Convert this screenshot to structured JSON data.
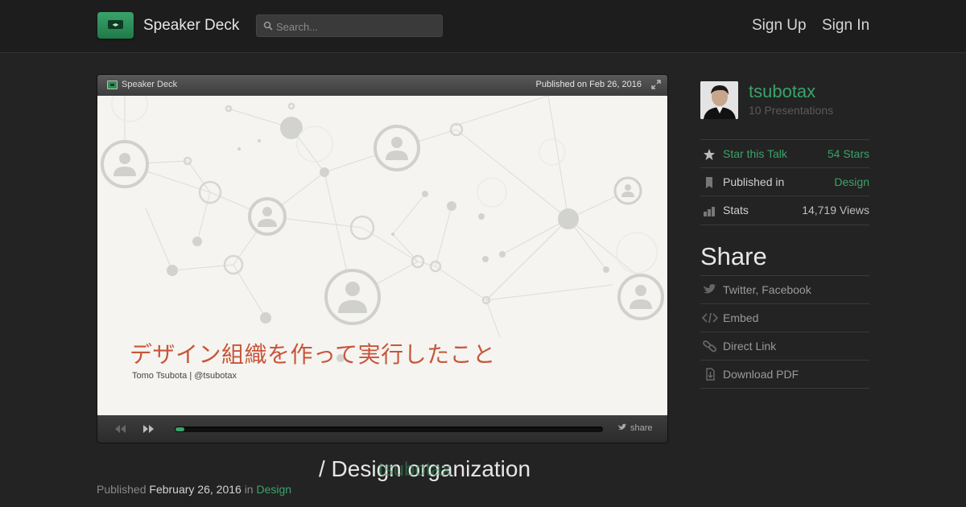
{
  "header": {
    "brand": "Speaker Deck",
    "search_placeholder": "Search...",
    "sign_up": "Sign Up",
    "sign_in": "Sign In"
  },
  "player": {
    "brand": "Speaker Deck",
    "published": "Published on Feb 26, 2016",
    "slide_title": "デザイン組織を作って実行したこと",
    "slide_author": "Tomo Tsubota  |  @tsubotax",
    "share_label": "share",
    "progress_fraction": 0.02
  },
  "talk": {
    "title": "/ Design organization",
    "overlay_author": "tsubotax",
    "published_prefix": "Published",
    "published_date": "February 26, 2016",
    "published_in": "in",
    "category": "Design"
  },
  "sidebar": {
    "author_name": "tsubotax",
    "presentations": "10 Presentations",
    "stats": [
      {
        "icon": "star-icon",
        "label": "Star this Talk",
        "value": "54 Stars"
      },
      {
        "icon": "bookmark-icon",
        "label": "Published in",
        "value": "Design"
      },
      {
        "icon": "bar-chart-icon",
        "label": "Stats",
        "value": "14,719 Views"
      }
    ],
    "share_heading": "Share",
    "share_items": [
      {
        "icon": "twitter-icon",
        "label": "Twitter, Facebook"
      },
      {
        "icon": "code-icon",
        "label": "Embed"
      },
      {
        "icon": "link-icon",
        "label": "Direct Link"
      },
      {
        "icon": "download-icon",
        "label": "Download PDF"
      }
    ]
  },
  "colors": {
    "accent": "#3aa36a",
    "background": "#232323",
    "slide_title": "#c8553a"
  }
}
